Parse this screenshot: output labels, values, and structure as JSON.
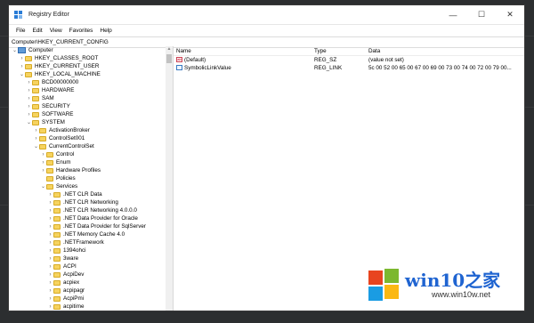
{
  "window": {
    "title": "Registry Editor"
  },
  "window_controls": {
    "minimize": "—",
    "maximize": "☐",
    "close": "✕"
  },
  "menu": [
    "File",
    "Edit",
    "View",
    "Favorites",
    "Help"
  ],
  "address": "Computer\\HKEY_CURRENT_CONFIG",
  "tree": [
    {
      "label": "Computer",
      "depth": 0,
      "chev": "⌄",
      "icon": "computer"
    },
    {
      "label": "HKEY_CLASSES_ROOT",
      "depth": 1,
      "chev": "›",
      "icon": "folder"
    },
    {
      "label": "HKEY_CURRENT_USER",
      "depth": 1,
      "chev": "›",
      "icon": "folder"
    },
    {
      "label": "HKEY_LOCAL_MACHINE",
      "depth": 1,
      "chev": "⌄",
      "icon": "folder"
    },
    {
      "label": "BCD00000000",
      "depth": 2,
      "chev": "›",
      "icon": "folder"
    },
    {
      "label": "HARDWARE",
      "depth": 2,
      "chev": "›",
      "icon": "folder"
    },
    {
      "label": "SAM",
      "depth": 2,
      "chev": "›",
      "icon": "folder"
    },
    {
      "label": "SECURITY",
      "depth": 2,
      "chev": "›",
      "icon": "folder"
    },
    {
      "label": "SOFTWARE",
      "depth": 2,
      "chev": "›",
      "icon": "folder"
    },
    {
      "label": "SYSTEM",
      "depth": 2,
      "chev": "⌄",
      "icon": "folder"
    },
    {
      "label": "ActivationBroker",
      "depth": 3,
      "chev": "›",
      "icon": "folder"
    },
    {
      "label": "ControlSet001",
      "depth": 3,
      "chev": "›",
      "icon": "folder"
    },
    {
      "label": "CurrentControlSet",
      "depth": 3,
      "chev": "⌄",
      "icon": "folder"
    },
    {
      "label": "Control",
      "depth": 4,
      "chev": "›",
      "icon": "folder"
    },
    {
      "label": "Enum",
      "depth": 4,
      "chev": "›",
      "icon": "folder"
    },
    {
      "label": "Hardware Profiles",
      "depth": 4,
      "chev": "›",
      "icon": "folder"
    },
    {
      "label": "Policies",
      "depth": 4,
      "chev": "",
      "icon": "folder"
    },
    {
      "label": "Services",
      "depth": 4,
      "chev": "⌄",
      "icon": "folder"
    },
    {
      "label": ".NET CLR Data",
      "depth": 5,
      "chev": "›",
      "icon": "folder"
    },
    {
      "label": ".NET CLR Networking",
      "depth": 5,
      "chev": "›",
      "icon": "folder"
    },
    {
      "label": ".NET CLR Networking 4.0.0.0",
      "depth": 5,
      "chev": "›",
      "icon": "folder"
    },
    {
      "label": ".NET Data Provider for Oracle",
      "depth": 5,
      "chev": "›",
      "icon": "folder"
    },
    {
      "label": ".NET Data Provider for SqlServer",
      "depth": 5,
      "chev": "›",
      "icon": "folder"
    },
    {
      "label": ".NET Memory Cache 4.0",
      "depth": 5,
      "chev": "›",
      "icon": "folder"
    },
    {
      "label": ".NETFramework",
      "depth": 5,
      "chev": "›",
      "icon": "folder"
    },
    {
      "label": "1394ohci",
      "depth": 5,
      "chev": "›",
      "icon": "folder"
    },
    {
      "label": "3ware",
      "depth": 5,
      "chev": "›",
      "icon": "folder"
    },
    {
      "label": "ACPI",
      "depth": 5,
      "chev": "›",
      "icon": "folder"
    },
    {
      "label": "AcpiDev",
      "depth": 5,
      "chev": "›",
      "icon": "folder"
    },
    {
      "label": "acpiex",
      "depth": 5,
      "chev": "›",
      "icon": "folder"
    },
    {
      "label": "acpipagr",
      "depth": 5,
      "chev": "›",
      "icon": "folder"
    },
    {
      "label": "AcpiPmi",
      "depth": 5,
      "chev": "›",
      "icon": "folder"
    },
    {
      "label": "acpitime",
      "depth": 5,
      "chev": "›",
      "icon": "folder"
    }
  ],
  "columns": {
    "name": "Name",
    "type": "Type",
    "data": "Data"
  },
  "values": [
    {
      "name": "(Default)",
      "type": "REG_SZ",
      "data": "(value not set)",
      "icon": "string"
    },
    {
      "name": "SymbolicLinkValue",
      "type": "REG_LINK",
      "data": "5c 00 52 00 65 00 67 00 69 00 73 00 74 00 72 00 79 00...",
      "icon": "binary"
    }
  ],
  "watermark": {
    "main": "win10之家",
    "sub": "www.win10w.net"
  },
  "colors": {
    "watermark_blue": "#1f64d1",
    "folder": "#f6d35f",
    "logo_red": "#e8441f",
    "logo_green": "#7cb82f",
    "logo_blue": "#1a9ce3",
    "logo_yellow": "#fbb813"
  }
}
